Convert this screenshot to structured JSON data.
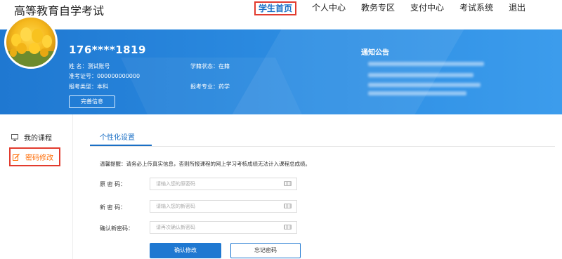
{
  "header": {
    "site_title": "高等教育自学考试",
    "nav": [
      {
        "label": "学生首页",
        "active": true
      },
      {
        "label": "个人中心"
      },
      {
        "label": "教务专区"
      },
      {
        "label": "支付中心"
      },
      {
        "label": "考试系统"
      },
      {
        "label": "退出"
      }
    ]
  },
  "profile": {
    "user_id": "176****1819",
    "name_label": "姓       名：",
    "name_value": "测试账号",
    "exam_no_label": "准考证号：",
    "exam_no_value": "000000000000",
    "exam_type_label": "报考类型：",
    "exam_type_value": "本科",
    "status_label": "学籍状态：",
    "status_value": "在籍",
    "major_label": "报考专业：",
    "major_value": "药学",
    "complete_button": "完善信息"
  },
  "notice": {
    "title": "通知公告"
  },
  "sidebar": {
    "items": [
      {
        "label": "我的课程",
        "icon": "monitor-icon"
      },
      {
        "label": "密码修改",
        "icon": "edit-icon",
        "active": true
      }
    ]
  },
  "main": {
    "tab_label": "个性化设置",
    "reminder": "温馨提醒：请务必上传真实信息，否则所报课程的网上学习考核成绩无法计入课程总成绩。",
    "fields": [
      {
        "label": "原   密   码：",
        "placeholder": "请输入您的原密码"
      },
      {
        "label": "新   密   码：",
        "placeholder": "请输入您的新密码"
      },
      {
        "label": "确认新密码：",
        "placeholder": "请再次确认新密码"
      }
    ],
    "confirm_button": "确认修改",
    "forgot_button": "忘记密码"
  },
  "colors": {
    "primary": "#1f78d1",
    "highlight_border": "#e23b2e",
    "active_sidebar_text": "#ff6a00"
  }
}
